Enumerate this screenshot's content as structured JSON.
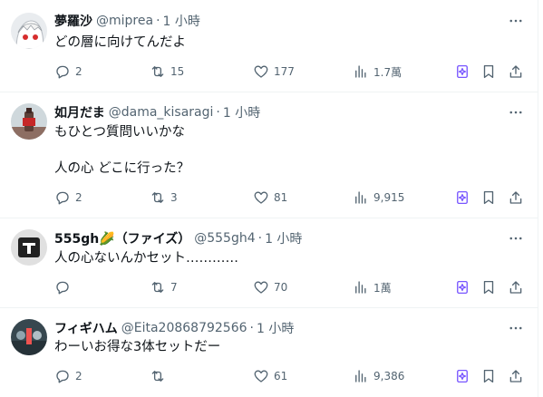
{
  "tweets": [
    {
      "name": "夢羅沙",
      "handle": "@miprea",
      "time": "1 小時",
      "text": "どの層に向けてんだよ",
      "replies": "2",
      "retweets": "15",
      "likes": "177",
      "views": "1.7萬"
    },
    {
      "name": "如月だま",
      "handle": "@dama_kisaragi",
      "time": "1 小時",
      "text": "もひとつ質問いいかな\n\n人の心 どこに行った？",
      "replies": "2",
      "retweets": "3",
      "likes": "81",
      "views": "9,915"
    },
    {
      "name": "555gh🌽（ファイズ）",
      "handle": "@555gh4",
      "time": "1 小時",
      "text": "人の心ないんかセット…………",
      "replies": "",
      "retweets": "7",
      "likes": "70",
      "views": "1萬"
    },
    {
      "name": "フィギハム",
      "handle": "@Eita20868792566",
      "time": "1 小時",
      "text": "わーいお得な3体セットだー",
      "replies": "2",
      "retweets": "",
      "likes": "61",
      "views": "9,386"
    }
  ],
  "separator": "·",
  "icons": {
    "reply": "reply-icon",
    "retweet": "retweet-icon",
    "like": "heart-icon",
    "views": "views-icon",
    "grok": "grok-icon",
    "bookmark": "bookmark-icon",
    "share": "share-icon",
    "more": "more-icon"
  },
  "colors": {
    "text": "#0f1419",
    "secondary": "#536471",
    "grok": "#7856ff",
    "border": "#eff3f4"
  }
}
